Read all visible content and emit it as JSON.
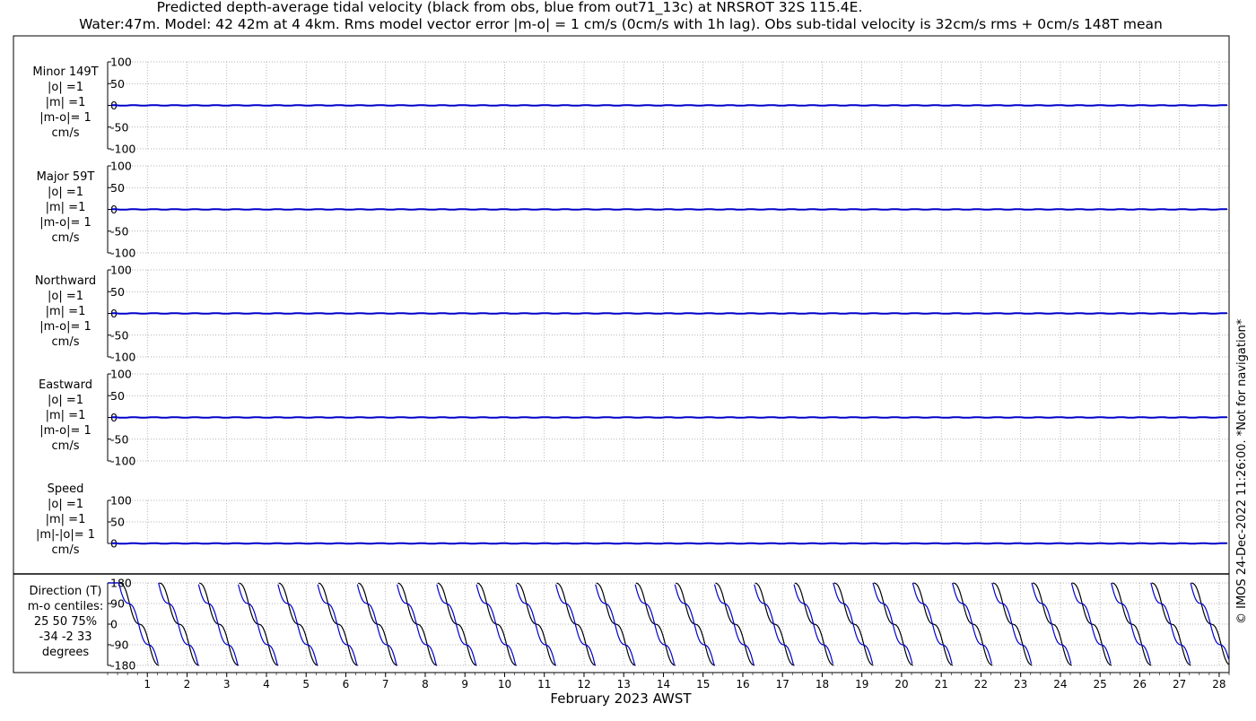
{
  "title": "Predicted depth-average tidal velocity (black from obs, blue from out71_13c) at NRSROT 32S 115.4E.",
  "subtitle": "Water:47m. Model: 42 42m at 4 4km. Rms model vector error |m-o| = 1 cm/s (0cm/s with 1h lag). Obs sub-tidal velocity is 32cm/s rms + 0cm/s 148T mean",
  "credit": "© IMOS 24-Dec-2022 11:26:00.  *Not for navigation*",
  "colors": {
    "obs": "#000000",
    "model": "#0000cc",
    "grid": "#9a9a9a"
  },
  "chart_data": [
    {
      "type": "line",
      "label_lines": [
        "Minor 149T",
        "|o| =1",
        "|m| =1",
        "|m-o|= 1",
        "cm/s"
      ],
      "ylim": [
        -100,
        100
      ],
      "yticks": [
        "100",
        "50",
        "0",
        "-50",
        "-100"
      ],
      "series": [
        {
          "name": "obs",
          "level": 0
        },
        {
          "name": "model",
          "level": 0
        }
      ]
    },
    {
      "type": "line",
      "label_lines": [
        "Major 59T",
        "|o| =1",
        "|m| =1",
        "|m-o|= 1",
        "cm/s"
      ],
      "ylim": [
        -100,
        100
      ],
      "yticks": [
        "100",
        "50",
        "0",
        "-50",
        "-100"
      ],
      "series": [
        {
          "name": "obs",
          "level": 0
        },
        {
          "name": "model",
          "level": 0
        }
      ]
    },
    {
      "type": "line",
      "label_lines": [
        "Northward",
        "|o| =1",
        "|m| =1",
        "|m-o|= 1",
        "cm/s"
      ],
      "ylim": [
        -100,
        100
      ],
      "yticks": [
        "100",
        "50",
        "0",
        "-50",
        "-100"
      ],
      "series": [
        {
          "name": "obs",
          "level": 0
        },
        {
          "name": "model",
          "level": 0
        }
      ]
    },
    {
      "type": "line",
      "label_lines": [
        "Eastward",
        "|o| =1",
        "|m| =1",
        "|m-o|= 1",
        "cm/s"
      ],
      "ylim": [
        -100,
        100
      ],
      "yticks": [
        "100",
        "50",
        "0",
        "-50",
        "-100"
      ],
      "series": [
        {
          "name": "obs",
          "level": 0
        },
        {
          "name": "model",
          "level": 0
        }
      ]
    },
    {
      "type": "line",
      "label_lines": [
        "Speed",
        "|o| =1",
        "|m| =1",
        "|m|-|o|= 1",
        "cm/s"
      ],
      "ylim": [
        0,
        100
      ],
      "yticks": [
        "100",
        "50",
        "0"
      ],
      "series": [
        {
          "name": "obs",
          "level": 0
        },
        {
          "name": "model",
          "level": 0
        }
      ]
    },
    {
      "type": "line",
      "label_lines": [
        "Direction (T)",
        "m-o centiles:",
        "25  50  75%",
        "-34  -2  33",
        "degrees"
      ],
      "ylim": [
        -180,
        180
      ],
      "yticks": [
        "180",
        "90",
        "0",
        "-90",
        "-180"
      ],
      "period_days": 1.0,
      "series": [
        {
          "name": "obs"
        },
        {
          "name": "model"
        }
      ]
    }
  ],
  "xaxis": {
    "xlabel": "February 2023 AWST",
    "xlim_days": [
      0,
      28.25
    ],
    "ticks": [
      "1",
      "2",
      "3",
      "4",
      "5",
      "6",
      "7",
      "8",
      "9",
      "10",
      "11",
      "12",
      "13",
      "14",
      "15",
      "16",
      "17",
      "18",
      "19",
      "20",
      "21",
      "22",
      "23",
      "24",
      "25",
      "26",
      "27",
      "28"
    ]
  }
}
